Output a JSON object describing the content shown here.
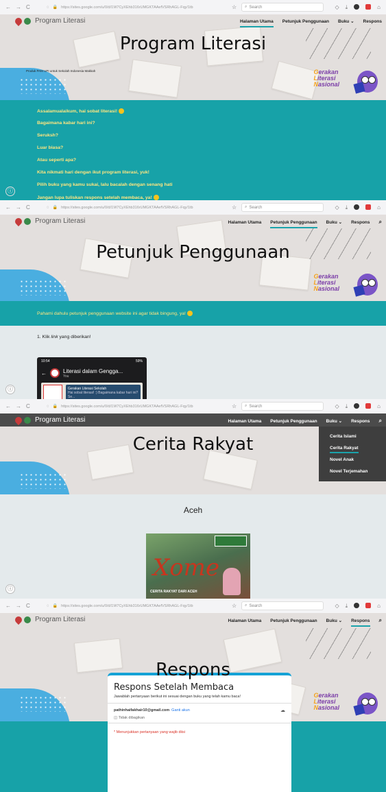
{
  "browser": {
    "url": "https://sites.google.com/u/0/d/1W7CyXEhb316rUMGKTAAefVSRhAGL-Fqy/1tb",
    "domain": "google.com",
    "search_placeholder": "Search"
  },
  "site": {
    "brand": "Program Literasi",
    "menu": {
      "home": "Halaman Utama",
      "guide": "Petunjuk Penggunaan",
      "books": "Buku",
      "response": "Respons"
    },
    "gln": [
      "erakan",
      "iterasi",
      "asional"
    ],
    "gln_initials": [
      "G",
      "L",
      "N"
    ]
  },
  "panel1": {
    "title": "Program Literasi",
    "subtitle": "Produk PAM UPI untuk Sekolah Indonesia Makkah",
    "messages": [
      "Assalamualaikum, hai sobat literasi!",
      "Bagaimana kabar hari ini?",
      "Seruksh?",
      "Luar biasa?",
      "Atau seperti apa?",
      "Kita nikmati hari dengan ikut program literasi, yuk!",
      "Pilih buku yang kamu sukai, lalu bacalah dengan senang hati",
      "Jangan lupa tuliskan respons setelah membaca, ya!"
    ]
  },
  "panel2": {
    "title": "Petunjuk Penggunaan",
    "intro": "Pahami dahulu petunjuk penggunaan website ini agar tidak bingung, ya!",
    "step1_prefix": "1. Klik ",
    "step1_link": "link",
    "step1_suffix": " yang diberikan!",
    "phone": {
      "time": "10:54",
      "status": "59%",
      "chat_title": "Literasi dalam Gengga...",
      "chat_sub": "You",
      "bubble_title": "Gerakan Literasi Sekolah",
      "bubble_text": "Hai sobat literasi! :) Bagaimana kabar hari ini? Se..."
    }
  },
  "panel3": {
    "title": "Cerita Rakyat",
    "region": "Aceh",
    "dropdown": [
      "Cerita Islami",
      "Cerita Rakyat",
      "Novel Anak",
      "Novel Terjemahan"
    ],
    "cover_title": "Xome",
    "cover_label": "CERITA RAKYAT DARI ACEH"
  },
  "panel4": {
    "title": "Respons",
    "form_title": "Respons Setelah Membaca",
    "form_desc": "Jawablah pertanyaan berikut ini sesuai dengan buku yang telah kamu baca!",
    "email": "pathinhaifakhair10@gmail.com",
    "switch": "Ganti akun",
    "not_shared": "Tidak dibagikan",
    "required": "* Menunjukkan pertanyaan yang wajib diisi"
  },
  "colors": {
    "teal": "#17a2a8",
    "accent": "#1aa3ab",
    "gln_purple": "#7c3fa8",
    "gln_orange": "#f5a21c"
  }
}
